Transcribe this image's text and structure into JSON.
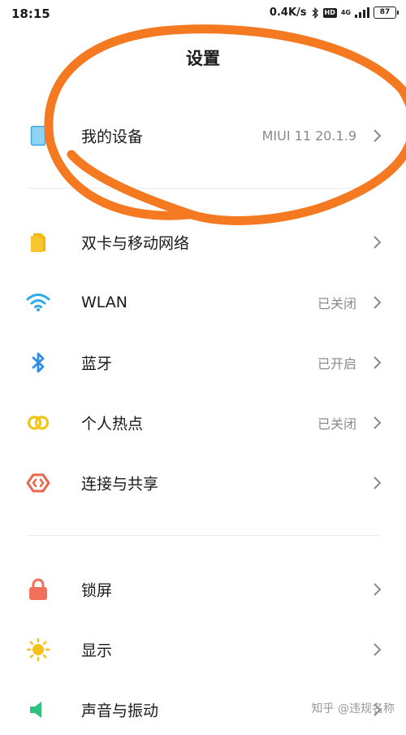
{
  "status_bar": {
    "time": "18:15",
    "net_speed": "0.4K/s",
    "hd_badge": "HD",
    "network_type": "4G",
    "battery": "87",
    "icons": [
      "bluetooth-icon",
      "signal-icon",
      "battery-icon"
    ]
  },
  "page_title": "设置",
  "device_row": {
    "label": "我的设备",
    "value": "MIUI 11 20.1.9",
    "icon": "tablet-icon"
  },
  "network_items": [
    {
      "label": "双卡与移动网络",
      "value": "",
      "icon": "sim-card-icon",
      "color": "#F5B800"
    },
    {
      "label": "WLAN",
      "value": "已关闭",
      "icon": "wifi-icon",
      "color": "#2EA8E6"
    },
    {
      "label": "蓝牙",
      "value": "已开启",
      "icon": "bluetooth-icon",
      "color": "#2E8EE6"
    },
    {
      "label": "个人热点",
      "value": "已关闭",
      "icon": "hotspot-icon",
      "color": "#F0C419"
    },
    {
      "label": "连接与共享",
      "value": "",
      "icon": "share-connection-icon",
      "color": "#E8664A"
    }
  ],
  "display_items": [
    {
      "label": "锁屏",
      "value": "",
      "icon": "lock-icon",
      "color": "#F0705A"
    },
    {
      "label": "显示",
      "value": "",
      "icon": "brightness-icon",
      "color": "#F5C21B"
    },
    {
      "label": "声音与振动",
      "value": "",
      "icon": "sound-icon",
      "color": "#2EC27E"
    }
  ],
  "annotation": {
    "color": "#F47920"
  },
  "watermark": "知乎 @违规名称"
}
